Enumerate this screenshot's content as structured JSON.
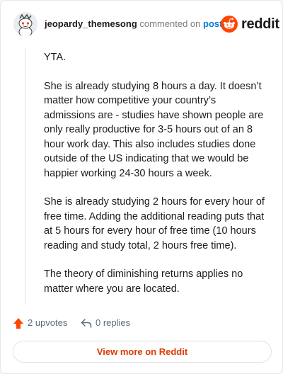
{
  "header": {
    "username": "jeopardy_themesong",
    "verb": "commented on",
    "post_link": "post",
    "brand": "reddit"
  },
  "comment": {
    "paragraphs": [
      "YTA.",
      "She is already studying 8 hours a day. It doesn’t matter how competitive your country’s admissions are - studies have shown people are only really productive for 3-5 hours out of an 8 hour work day. This also includes studies done outside of the US indicating that we would be happier working 24-30 hours a week.",
      "She is already studying 2 hours for every hour of free time. Adding the additional reading puts that at 5 hours for every hour of free time (10 hours reading and study total, 2 hours free time).",
      "The theory of diminishing returns applies no matter where you are located."
    ]
  },
  "actions": {
    "upvotes": "2 upvotes",
    "replies": "0 replies"
  },
  "footer": {
    "view_more": "View more on Reddit"
  },
  "colors": {
    "reddit_orange": "#ff4500",
    "link_blue": "#0079d3",
    "view_more_text": "#d93a00"
  },
  "icons": {
    "avatar": "snoo-avatar",
    "brand": "reddit-logo-icon",
    "upvote": "upvote-arrow-icon",
    "reply": "reply-arrow-icon"
  }
}
